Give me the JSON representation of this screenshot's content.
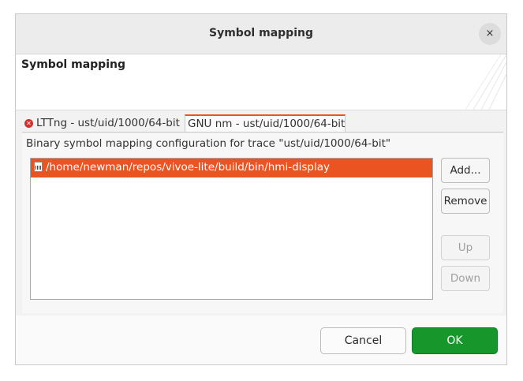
{
  "dialog": {
    "title": "Symbol mapping",
    "close_glyph": "×",
    "banner_title": "Symbol mapping"
  },
  "tabs": [
    {
      "label": "LTTng - ust/uid/1000/64-bit",
      "status_icon": "error-icon",
      "selected": false
    },
    {
      "label": "GNU nm - ust/uid/1000/64-bit",
      "selected": true
    }
  ],
  "panel": {
    "description": "Binary symbol mapping configuration for trace \"ust/uid/1000/64-bit\"",
    "files": [
      {
        "path": "/home/newman/repos/vivoe-lite/build/bin/hmi-display",
        "icon": "binary-file-icon",
        "selected": true
      }
    ],
    "buttons": {
      "add": "Add...",
      "remove": "Remove",
      "up": "Up",
      "down": "Down"
    }
  },
  "footer": {
    "cancel": "Cancel",
    "ok": "OK"
  },
  "colors": {
    "accent": "#e95420",
    "ok_button": "#17962c",
    "error_icon": "#d52f2f"
  }
}
